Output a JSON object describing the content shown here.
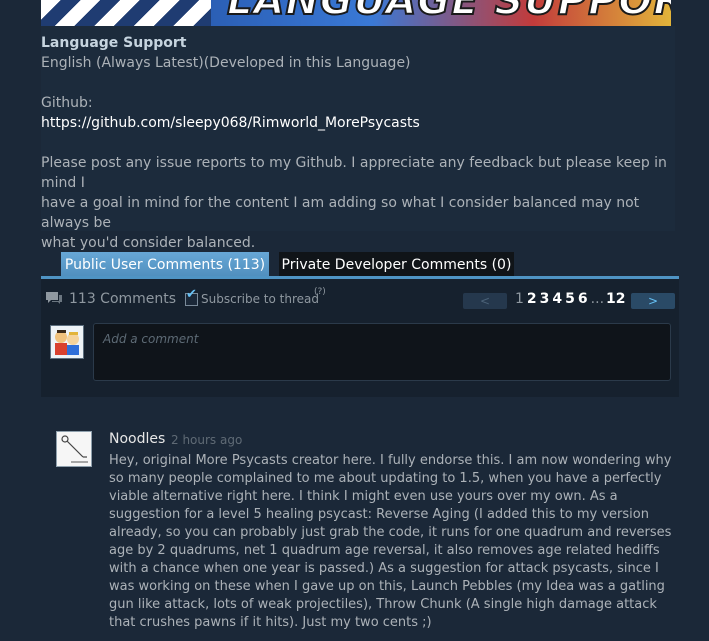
{
  "banner": {
    "art_text": "LANGUAGE SUPPORT!"
  },
  "description": {
    "language_heading": "Language Support",
    "language_value": "English (Always Latest)(Developed in this Language)",
    "github_label": "Github:",
    "github_link": "https://github.com/sleepy068/Rimworld_MorePsycasts",
    "note_lines": [
      "Please post any issue reports to my Github. I appreciate any feedback but please keep in mind I",
      "have a goal in mind for the content I am adding so what I consider balanced may not always be",
      "what you'd consider balanced."
    ]
  },
  "tabs": {
    "public": "Public User Comments (113)",
    "private": "Private Developer Comments (0)"
  },
  "comments_header": {
    "count": "113 Comments",
    "subscribe": "Subscribe to thread",
    "help": "(?)",
    "subscribed": true
  },
  "pagination": {
    "prev": "<",
    "next": ">",
    "pages": [
      "1",
      "2",
      "3",
      "4",
      "5",
      "6"
    ],
    "current": "1",
    "ellipsis": "...",
    "last": "12"
  },
  "comment_box": {
    "placeholder": "Add a comment"
  },
  "comment": {
    "author": "Noodles",
    "time": "2 hours ago",
    "lines": [
      "Hey, original More Psycasts creator here. I fully endorse this. I am now wondering why",
      "so many people complained to me about updating to 1.5, when you have a perfectly",
      "viable alternative right here. I think I might even use yours over my own. As a",
      "suggestion for a level 5 healing psycast: Reverse Aging (I added this to my version",
      "already, so you can probably just grab the code, it runs for one quadrum and reverses",
      "age by 2 quadrums, net 1 quadrum age reversal, it also removes age related hediffs",
      "with a chance when one year is passed.) As a suggestion for attack psycasts, since I",
      "was working on these when I gave up on this, Launch Pebbles (my Idea was a gatling",
      "gun like attack, lots of weak projectiles), Throw Chunk (A single high damage attack",
      "that crushes pawns if it hits). Just my two cents ;)"
    ]
  },
  "colors": {
    "background": "#1b2838",
    "accent": "#66c0f4",
    "tab_active": "#5f9fcf"
  }
}
